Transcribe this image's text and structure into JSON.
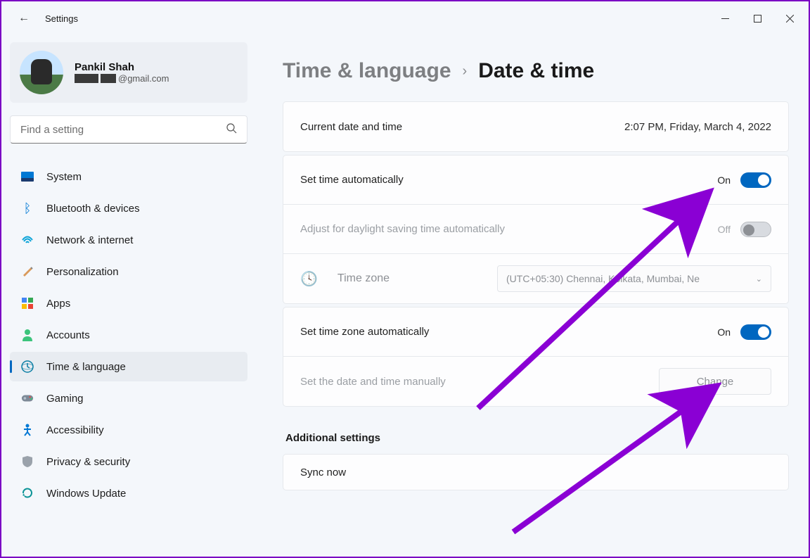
{
  "window": {
    "title": "Settings"
  },
  "user": {
    "name": "Pankil Shah",
    "email_suffix": "@gmail.com"
  },
  "search": {
    "placeholder": "Find a setting"
  },
  "sidebar": {
    "items": [
      {
        "label": "System"
      },
      {
        "label": "Bluetooth & devices"
      },
      {
        "label": "Network & internet"
      },
      {
        "label": "Personalization"
      },
      {
        "label": "Apps"
      },
      {
        "label": "Accounts"
      },
      {
        "label": "Time & language"
      },
      {
        "label": "Gaming"
      },
      {
        "label": "Accessibility"
      },
      {
        "label": "Privacy & security"
      },
      {
        "label": "Windows Update"
      }
    ],
    "active_index": 6
  },
  "breadcrumb": {
    "parent": "Time & language",
    "current": "Date & time"
  },
  "rows": {
    "current_label": "Current date and time",
    "current_value": "2:07 PM, Friday, March 4, 2022",
    "set_time_auto_label": "Set time automatically",
    "set_time_auto_state": "On",
    "dst_label": "Adjust for daylight saving time automatically",
    "dst_state": "Off",
    "tz_label": "Time zone",
    "tz_value": "(UTC+05:30) Chennai, Kolkata, Mumbai, Ne",
    "set_tz_auto_label": "Set time zone automatically",
    "set_tz_auto_state": "On",
    "manual_label": "Set the date and time manually",
    "change_button": "Change"
  },
  "sections": {
    "additional": "Additional settings",
    "sync_now": "Sync now"
  },
  "colors": {
    "accent": "#0067c0",
    "arrow": "#8a00d4"
  }
}
